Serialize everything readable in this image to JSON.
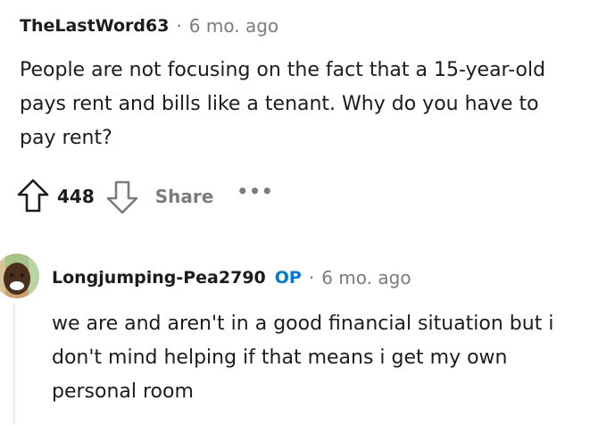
{
  "comment": {
    "author": "TheLastWord63",
    "separator": "·",
    "time": "6 mo. ago",
    "body": "People are not focusing on the fact that a 15-year-old pays rent and bills like a tenant. Why do you have to pay rent?",
    "score": "448",
    "share_label": "Share",
    "more_label": "•••",
    "icons": {
      "upvote": "upvote-arrow-icon",
      "downvote": "downvote-arrow-icon",
      "more": "more-options-icon"
    }
  },
  "reply": {
    "author": "Longjumping-Pea2790",
    "op_badge": "OP",
    "separator": "·",
    "time": "6 mo. ago",
    "body": "we are and aren't in a good financial situation but i don't mind helping if that means i get my own personal room",
    "colors": {
      "op": "#0079d3"
    }
  },
  "colors": {
    "meta_gray": "#7c7c7c",
    "text": "#1c1c1c",
    "thread_line": "#edeff1"
  }
}
